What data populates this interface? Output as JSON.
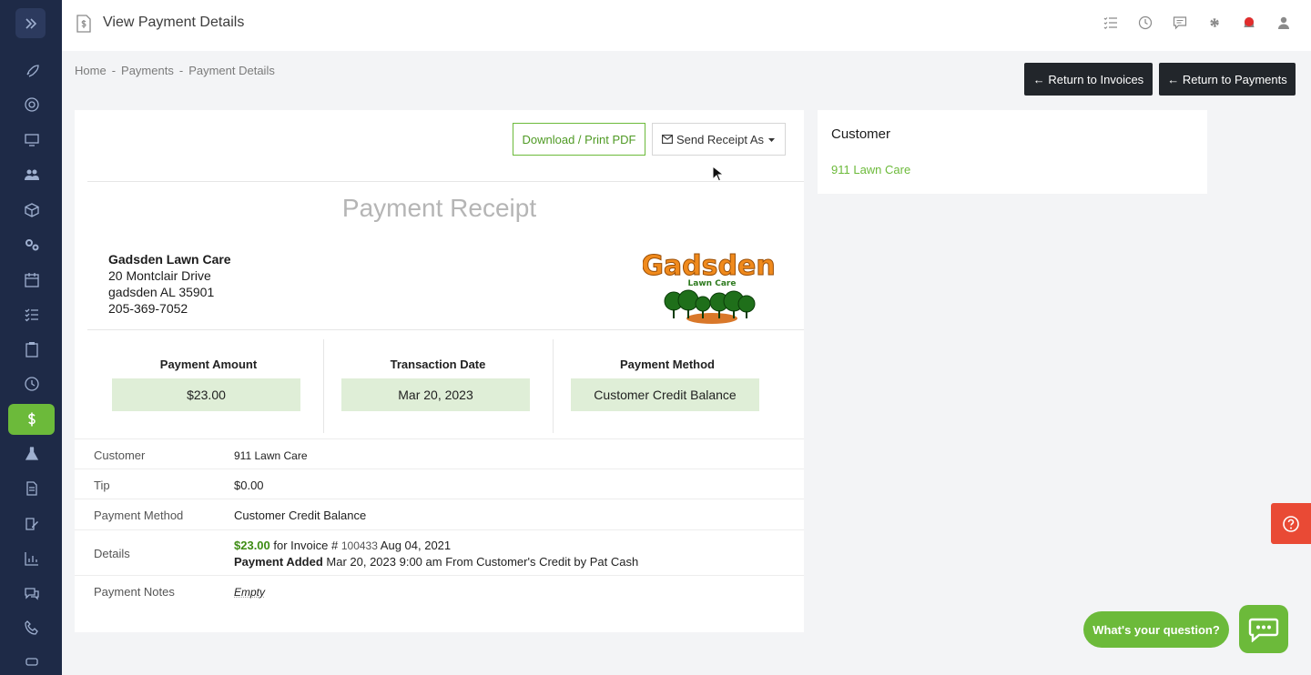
{
  "header": {
    "title": "View Payment Details"
  },
  "breadcrumb": {
    "home": "Home",
    "payments": "Payments",
    "current": "Payment Details",
    "sep": "-"
  },
  "actions": {
    "return_invoices": "← Return to Invoices",
    "return_payments": "← Return to Payments",
    "download_pdf": "Download / Print PDF",
    "send_receipt": "Send Receipt As"
  },
  "receipt": {
    "title": "Payment Receipt",
    "company": {
      "name": "Gadsden Lawn Care",
      "address1": "20 Montclair Drive",
      "address2": "gadsden AL 35901",
      "phone": "205-369-7052",
      "logo_text": "Gadsden",
      "logo_sub": "Lawn Care"
    },
    "stats": [
      {
        "label": "Payment Amount",
        "value": "$23.00"
      },
      {
        "label": "Transaction Date",
        "value": "Mar 20, 2023"
      },
      {
        "label": "Payment Method",
        "value": "Customer Credit Balance"
      }
    ],
    "rows": {
      "customer": {
        "label": "Customer",
        "value": "911 Lawn Care"
      },
      "tip": {
        "label": "Tip",
        "value": "$0.00"
      },
      "method": {
        "label": "Payment Method",
        "value": "Customer Credit Balance"
      },
      "details": {
        "label": "Details",
        "amount": "$23.00",
        "for_invoice": "for Invoice #",
        "invoice_no": "100433",
        "invoice_date": "Aug 04, 2021",
        "added_label": "Payment Added",
        "added_text": "Mar 20, 2023 9:00 am From Customer's Credit by Pat Cash"
      },
      "notes": {
        "label": "Payment Notes",
        "value": "Empty"
      }
    }
  },
  "customer_card": {
    "heading": "Customer",
    "name": "911 Lawn Care"
  },
  "chat": {
    "prompt": "What's your question?"
  },
  "colors": {
    "accent": "#6cba3a",
    "sidebar": "#1e2a47",
    "danger": "#e94a35"
  }
}
